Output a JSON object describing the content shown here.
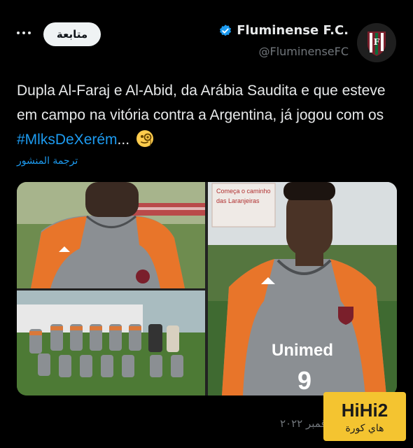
{
  "header": {
    "follow_label": "متابعة",
    "account_name": "Fluminense F.C.",
    "account_handle": "@FluminenseFC",
    "verified_color": "#1d9bf0",
    "more_icon": "more-dots-icon"
  },
  "tweet": {
    "text_before": "Dupla Al-Faraj e Al-Abid, da Arábia Saudita e que esteve em campo na vitória contra a Argentina, já jogou com os ",
    "hashtag": "#MlksDeXerém",
    "text_after": "... ",
    "emoji_icon": "face-with-monocle-icon",
    "translate_label": "ترجمة المنشور"
  },
  "media": {
    "photos": [
      {
        "name": "player-closeup-photo"
      },
      {
        "name": "team-photo"
      },
      {
        "name": "player-portrait-photo",
        "sign_text": "Começa o caminho das Laranjeiras",
        "shirt_sponsor": "Unimed",
        "shirt_number": "9"
      }
    ]
  },
  "footer": {
    "date": "ﻗﻤﺒﺮ ٢٠٢٢",
    "watermark_top": "HiHi2",
    "watermark_bottom": "هاي كورة"
  }
}
